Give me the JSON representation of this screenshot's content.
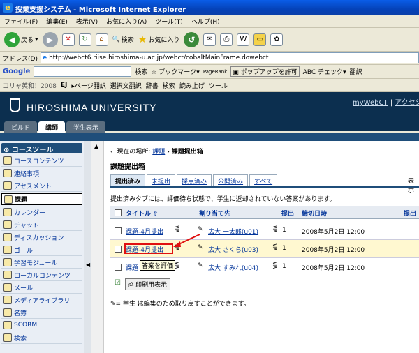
{
  "window": {
    "title": "授業支援システム - Microsoft Internet Explorer"
  },
  "menu": [
    "ファイル(F)",
    "編集(E)",
    "表示(V)",
    "お気に入り(A)",
    "ツール(T)",
    "ヘルプ(H)"
  ],
  "toolbar": {
    "back": "戻る",
    "search": "検索",
    "favorites": "お気に入り"
  },
  "address": {
    "label": "アドレス(D)",
    "url": "http://webct6.riise.hiroshima-u.ac.jp/webct/cobaltMainFrame.dowebct"
  },
  "google": {
    "brand": "Google",
    "search": "検索",
    "bookmarks": "ブックマーク",
    "pagerank": "PageRank",
    "popup": "ポップアップを許可",
    "check": "チェック",
    "translate": "翻訳"
  },
  "kanji": {
    "prefix": "コリャ英和！2008",
    "ej": "EJ",
    "page": "ページ翻訳",
    "select": "選択文翻訳",
    "dict": "辞書",
    "search": "検索",
    "read": "読み上げ",
    "tools": "ツール"
  },
  "header": {
    "brand": "HIROSHIMA UNIVERSITY",
    "mywebct": "myWebCT",
    "access": "アクセシ"
  },
  "roles": [
    {
      "label": "ビルド"
    },
    {
      "label": "講師"
    },
    {
      "label": "学生表示"
    }
  ],
  "sidebar": {
    "title": "コースツール",
    "items": [
      {
        "label": "コースコンテンツ"
      },
      {
        "label": "連絡事項"
      },
      {
        "label": "アセスメント"
      },
      {
        "label": "課題"
      },
      {
        "label": "カレンダー"
      },
      {
        "label": "チャット"
      },
      {
        "label": "ディスカッション"
      },
      {
        "label": "ゴール"
      },
      {
        "label": "学習モジュール"
      },
      {
        "label": "ローカルコンテンツ"
      },
      {
        "label": "メール"
      },
      {
        "label": "メディアライブラリ"
      },
      {
        "label": "名簿"
      },
      {
        "label": "SCORM"
      },
      {
        "label": "検索"
      }
    ]
  },
  "breadcrumb": {
    "prefix": "現在の場所:",
    "parent": "課題",
    "sep": "›",
    "current": "課題提出箱"
  },
  "page": {
    "title": "課題提出箱",
    "display_label": "表示"
  },
  "filter_tabs": [
    "提出済み",
    "未提出",
    "採点済み",
    "公開済み",
    "すべて"
  ],
  "note": "提出済みタブには、評価待ち状態で、学生に返却されていない答案があります。",
  "table": {
    "headers": {
      "title": "タイトル",
      "assignee": "割り当て先",
      "submissions": "提出",
      "deadline": "締切日時",
      "submit2": "提出"
    },
    "rows": [
      {
        "title": "課題-4月提出",
        "student": "広大 一太郎(u01)",
        "count": "1",
        "deadline": "2008年5月2日 12:00"
      },
      {
        "title": "課題-4月提出",
        "student": "広大 さくら(u03)",
        "count": "1",
        "deadline": "2008年5月2日 12:00"
      },
      {
        "title": "課題",
        "student": "広大 すみれ(u04)",
        "count": "1",
        "deadline": "2008年5月2日 12:00"
      }
    ]
  },
  "tooltip": "答案を評価",
  "print_button": "印刷用表示",
  "footnote": "= 学生 は編集のため取り戻すことができます。",
  "colors": {
    "header": "#0c2f4f",
    "highlight_row": "#fff8d0",
    "annotation": "#e01010"
  }
}
